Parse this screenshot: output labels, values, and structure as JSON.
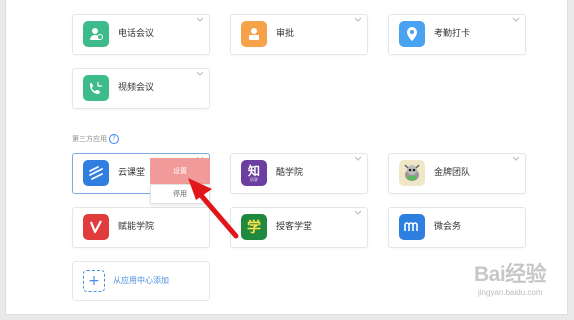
{
  "apps_top": [
    {
      "label": "电话会议",
      "icon": "phone-meeting-icon",
      "color": "#3dbb8a"
    },
    {
      "label": "审批",
      "icon": "approval-icon",
      "color": "#f5a24b"
    },
    {
      "label": "考勤打卡",
      "icon": "attendance-icon",
      "color": "#4aa3f0"
    },
    {
      "label": "视频会议",
      "icon": "video-meeting-icon",
      "color": "#3dbb8a"
    }
  ],
  "third_party": {
    "label": "第三方应用",
    "apps": [
      {
        "label": "云课堂",
        "icon": "cloud-classroom-icon",
        "color": "#2f7ee0"
      },
      {
        "label": "酷学院",
        "icon": "kuxueyuan-icon",
        "color": "#6b3fa0",
        "glyph": "知",
        "sub": "乐学"
      },
      {
        "label": "金牌团队",
        "icon": "gold-team-icon",
        "color": "#f0e6c8"
      },
      {
        "label": "赋能学院",
        "icon": "empower-academy-icon",
        "color": "#e03c3c"
      },
      {
        "label": "授客学堂",
        "icon": "shouke-classroom-icon",
        "color": "#1f8a3e",
        "glyph": "学"
      },
      {
        "label": "微会务",
        "icon": "micro-conference-icon",
        "color": "#2d7fe0"
      }
    ]
  },
  "popup": {
    "settings": "设置",
    "disable": "停用"
  },
  "add_app": "从应用中心添加",
  "watermark": {
    "main": "Bai经验",
    "sub": "jingyan.baidu.com"
  }
}
